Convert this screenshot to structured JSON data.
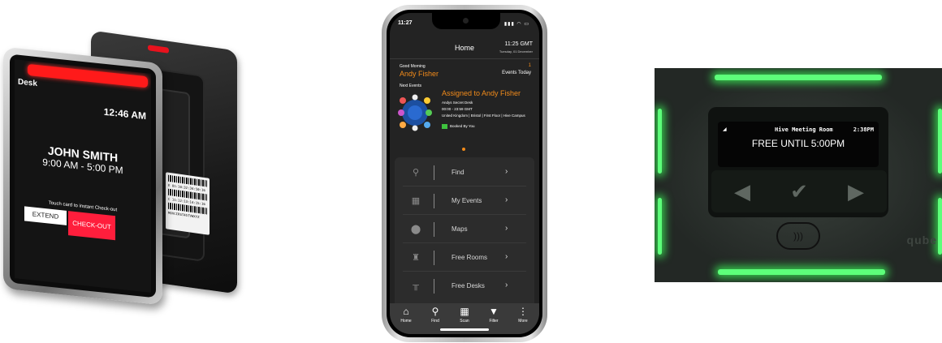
{
  "desk_panel": {
    "label": "Desk",
    "time": "12:46 AM",
    "name": "JOHN SMITH",
    "hours": "9:00 AM - 5:00 PM",
    "touch_hint": "Touch card to instant Check-out",
    "extend_label": "EXTEND",
    "checkout_label": "CHECK-OUT",
    "accent_color": "#ff1a1a",
    "barcode_lines": [
      "E 81:10:32:34:50:16",
      "C 11:12:13:14:15:16",
      "MOVCIRST45TVWXYZ"
    ]
  },
  "phone": {
    "status_time": "11:27",
    "status_icons": "▮▮▮ ◠ ▭",
    "header": {
      "title": "Home",
      "gmt_time": "11:25 GMT",
      "date": "Tuesday, 01 December"
    },
    "greeting": "Good Morning",
    "user_name": "Andy Fisher",
    "events_count": "1",
    "events_label": "Events Today",
    "next_events_label": "Next Events",
    "event": {
      "title": "Assigned to Andy Fisher",
      "desk": "Andys Secret Desk",
      "time": "00:00 - 23:59 GMT",
      "location": "United Kingdom | Bristol | First Floor | Hive Campus",
      "status": "Booked By You"
    },
    "menu": [
      {
        "icon": "search-icon",
        "label": "Find",
        "chevron": "›"
      },
      {
        "icon": "calendar-icon",
        "label": "My Events",
        "chevron": "›"
      },
      {
        "icon": "map-pin-icon",
        "label": "Maps",
        "chevron": "›"
      },
      {
        "icon": "room-icon",
        "label": "Free Rooms",
        "chevron": "›"
      },
      {
        "icon": "desk-icon",
        "label": "Free Desks",
        "chevron": "›"
      }
    ],
    "tabs": [
      {
        "icon": "home-icon",
        "glyph": "⌂",
        "label": "Home"
      },
      {
        "icon": "search-icon",
        "glyph": "⚲",
        "label": "Find"
      },
      {
        "icon": "qr-icon",
        "glyph": "▦",
        "label": "Scan"
      },
      {
        "icon": "filter-icon",
        "glyph": "▼",
        "label": "Filter"
      },
      {
        "icon": "more-icon",
        "glyph": "⋮",
        "label": "More"
      }
    ],
    "accent_color": "#f28b1a"
  },
  "room_panel": {
    "signal": "◢",
    "room_name": "Hive Meeting Room",
    "time": "2:38PM",
    "status": "FREE UNTIL 5:00PM",
    "keys": [
      "◀",
      "✔",
      "▶"
    ],
    "nfc_symbol": ")))",
    "brand": "qube",
    "glow_color": "#5dff7a"
  }
}
